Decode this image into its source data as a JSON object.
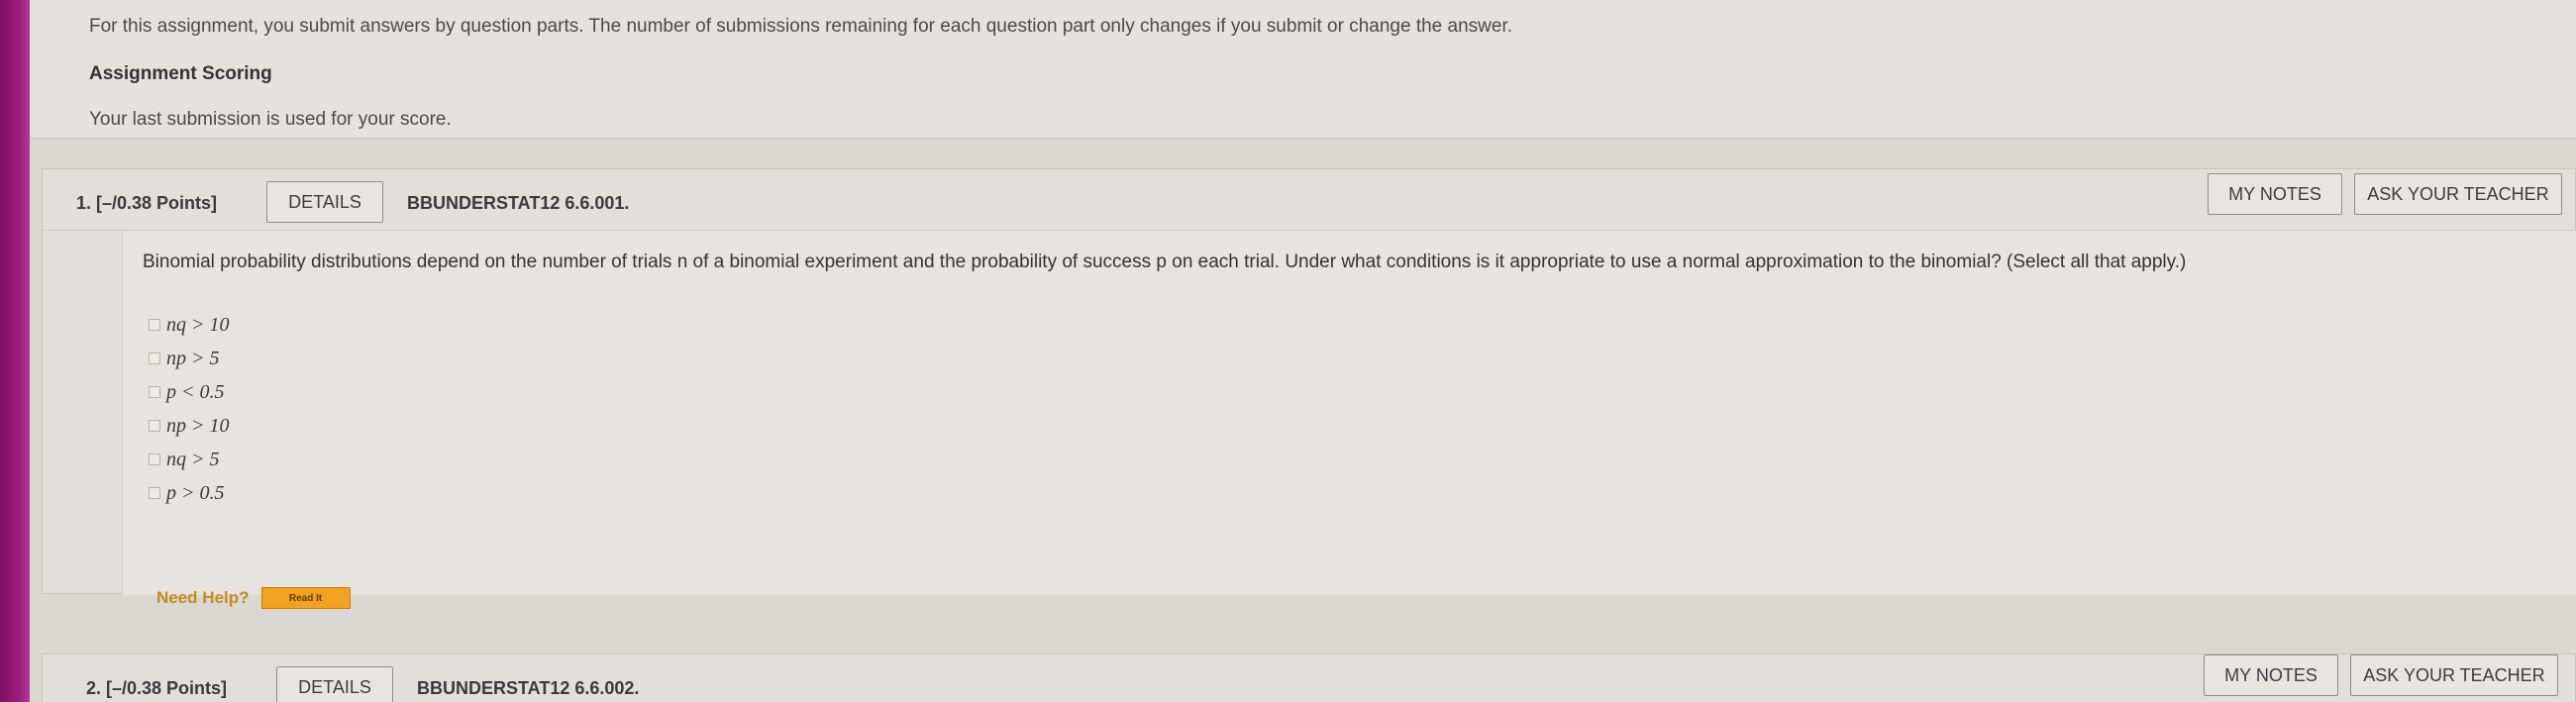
{
  "intro": {
    "text": "For this assignment, you submit answers by question parts. The number of submissions remaining for each question part only changes if you submit or change the answer.",
    "scoring_heading": "Assignment Scoring",
    "scoring_text": "Your last submission is used for your score."
  },
  "questions": [
    {
      "number": "1. [–/0.38 Points]",
      "details_label": "DETAILS",
      "code": "BBUNDERSTAT12 6.6.001.",
      "my_notes_label": "MY NOTES",
      "ask_teacher_label": "ASK YOUR TEACHER",
      "prompt": "Binomial probability distributions depend on the number of trials n of a binomial experiment and the probability of success p on each trial. Under what conditions is it appropriate to use a normal approximation to the binomial? (Select all that apply.)",
      "choices": [
        "nq > 10",
        "np > 5",
        "p < 0.5",
        "np > 10",
        "nq > 5",
        "p > 0.5"
      ],
      "need_help_label": "Need Help?",
      "read_it_label": "Read It"
    },
    {
      "number": "2. [–/0.38 Points]",
      "details_label": "DETAILS",
      "code": "BBUNDERSTAT12 6.6.002.",
      "my_notes_label": "MY NOTES",
      "ask_teacher_label": "ASK YOUR TEACHER"
    }
  ]
}
